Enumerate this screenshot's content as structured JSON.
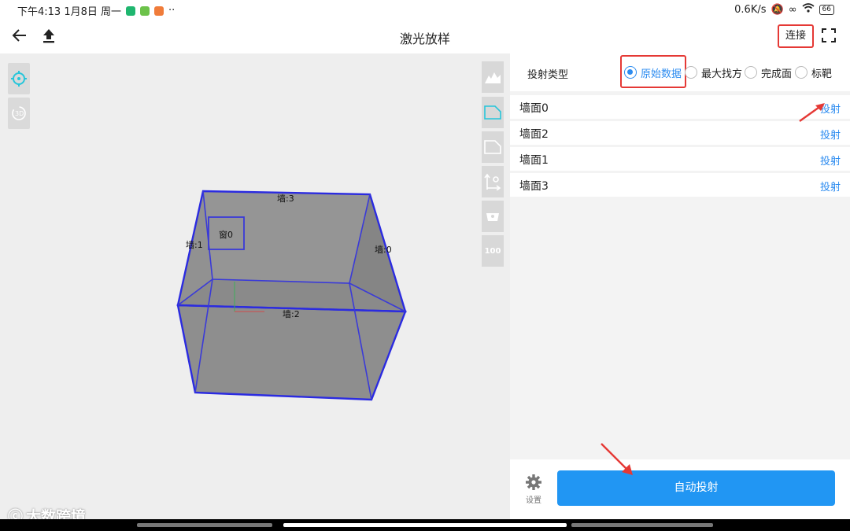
{
  "status": {
    "time": "下午4:13 1月8日 周一",
    "network": "0.6K/s",
    "battery": "66"
  },
  "header": {
    "title": "激光放样",
    "connect_label": "连接"
  },
  "viewport": {
    "wall_labels": [
      "墙:3",
      "墙:1",
      "窗0",
      "墙:0",
      "墙:2"
    ],
    "tool_100": "100",
    "watermark": "大数跨境"
  },
  "panel": {
    "type_label": "投射类型",
    "types": [
      {
        "label": "原始数据",
        "selected": true
      },
      {
        "label": "最大找方",
        "selected": false
      },
      {
        "label": "完成面",
        "selected": false
      },
      {
        "label": "标靶",
        "selected": false
      }
    ],
    "walls": [
      {
        "name": "墙面0",
        "action": "投射"
      },
      {
        "name": "墙面2",
        "action": "投射"
      },
      {
        "name": "墙面1",
        "action": "投射"
      },
      {
        "name": "墙面3",
        "action": "投射"
      }
    ],
    "settings_label": "设置",
    "auto_label": "自动投射"
  },
  "colors": {
    "accent": "#2196f3",
    "highlight": "#e53935",
    "box_edge": "#2b2be0",
    "box_fill": "#8c8c8c"
  }
}
